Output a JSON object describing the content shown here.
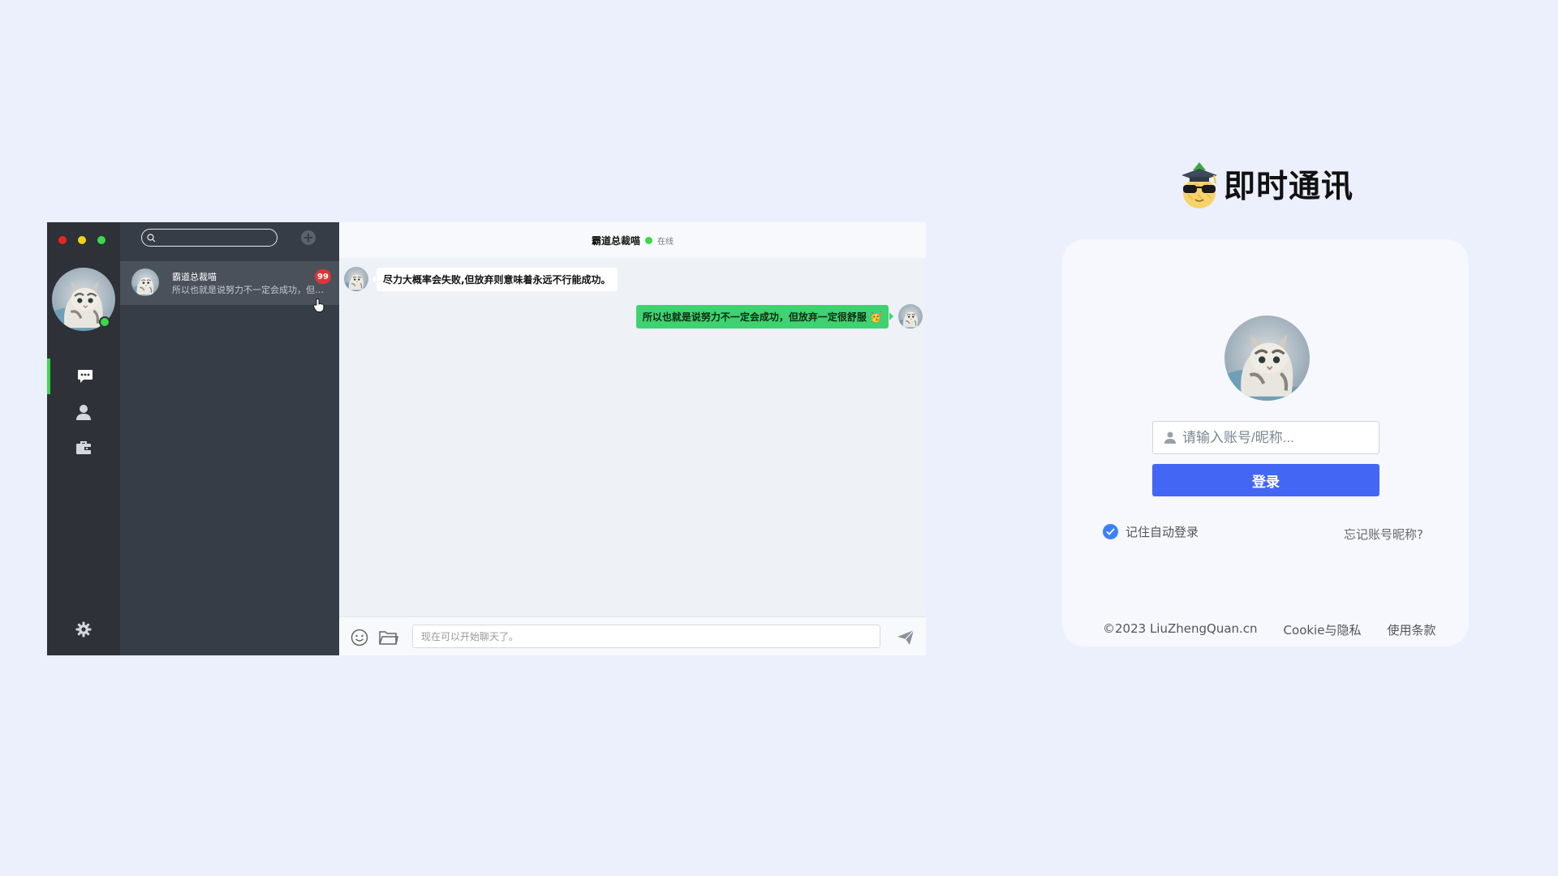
{
  "colors": {
    "background": "#ecf0fd",
    "sidebar": "#2e3238",
    "list_panel": "#363d47",
    "active_contact": "#4a515b",
    "online": "#3bd84c",
    "sent_bubble": "#3fd270",
    "badge": "#e03535",
    "primary_button": "#4466f5",
    "checkbox": "#3b82f6",
    "window_close": "#e8251c",
    "window_minimize": "#f0d319",
    "window_zoom": "#3bd84c"
  },
  "chat_app": {
    "window_controls": [
      "close",
      "minimize",
      "zoom"
    ],
    "nav": {
      "items": [
        {
          "icon": "chat-bubble-icon",
          "active": true
        },
        {
          "icon": "user-icon",
          "active": false
        },
        {
          "icon": "briefcase-icon",
          "active": false
        }
      ],
      "settings_icon": "gear-icon"
    },
    "search": {
      "placeholder": ""
    },
    "contacts": [
      {
        "name": "霸道总裁喵",
        "last_message": "所以也就是说努力不一定会成功，但放弃一定很舒服",
        "unread": "99"
      }
    ],
    "header": {
      "title": "霸道总裁喵",
      "status": "在线"
    },
    "messages": [
      {
        "side": "left",
        "text": "尽力大概率会失败,但放弃则意味着永远不行能成功。"
      },
      {
        "side": "right",
        "text": "所以也就是说努力不一定会成功，但放弃一定很舒服 🥳"
      }
    ],
    "composer": {
      "placeholder": "现在可以开始聊天了。"
    }
  },
  "login": {
    "brand_title": "即时通讯",
    "account_placeholder": "请输入账号/昵称...",
    "login_button": "登录",
    "remember_label": "记住自动登录",
    "remember_checked": true,
    "forgot_link": "忘记账号昵称?",
    "footer": {
      "copyright": "©2023 LiuZhengQuan.cn",
      "cookie": "Cookie与隐私",
      "terms": "使用条款"
    }
  }
}
